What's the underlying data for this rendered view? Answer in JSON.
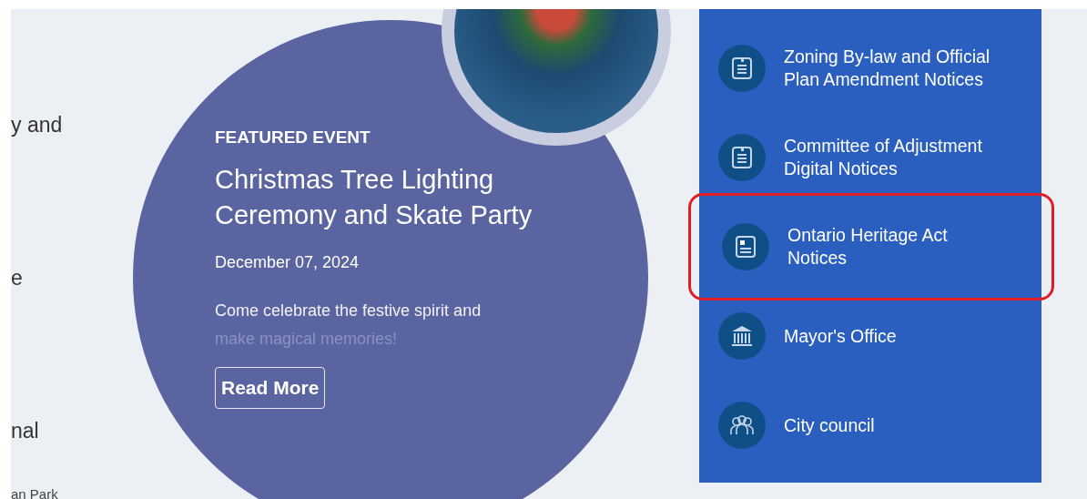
{
  "left_column": {
    "texts": [
      "y and",
      "e",
      "nal"
    ],
    "caption": "an Park"
  },
  "featured": {
    "eyebrow": "FEATURED EVENT",
    "title": "Christmas Tree Lighting Ceremony and Skate Party",
    "date": "December 07, 2024",
    "description": "Come celebrate the festive spirit and",
    "description_faded": "make magical memories!",
    "button": "Read More"
  },
  "links": [
    {
      "kind": "document",
      "label": "Zoning By-law and Official Plan Amendment Notices",
      "selected": false
    },
    {
      "kind": "document",
      "label": "Committee of Adjustment Digital Notices",
      "selected": false
    },
    {
      "kind": "notice",
      "label": "Ontario Heritage Act Notices",
      "selected": true
    },
    {
      "kind": "building",
      "label": "Mayor's Office",
      "selected": false
    },
    {
      "kind": "people",
      "label": "City council",
      "selected": false
    }
  ]
}
